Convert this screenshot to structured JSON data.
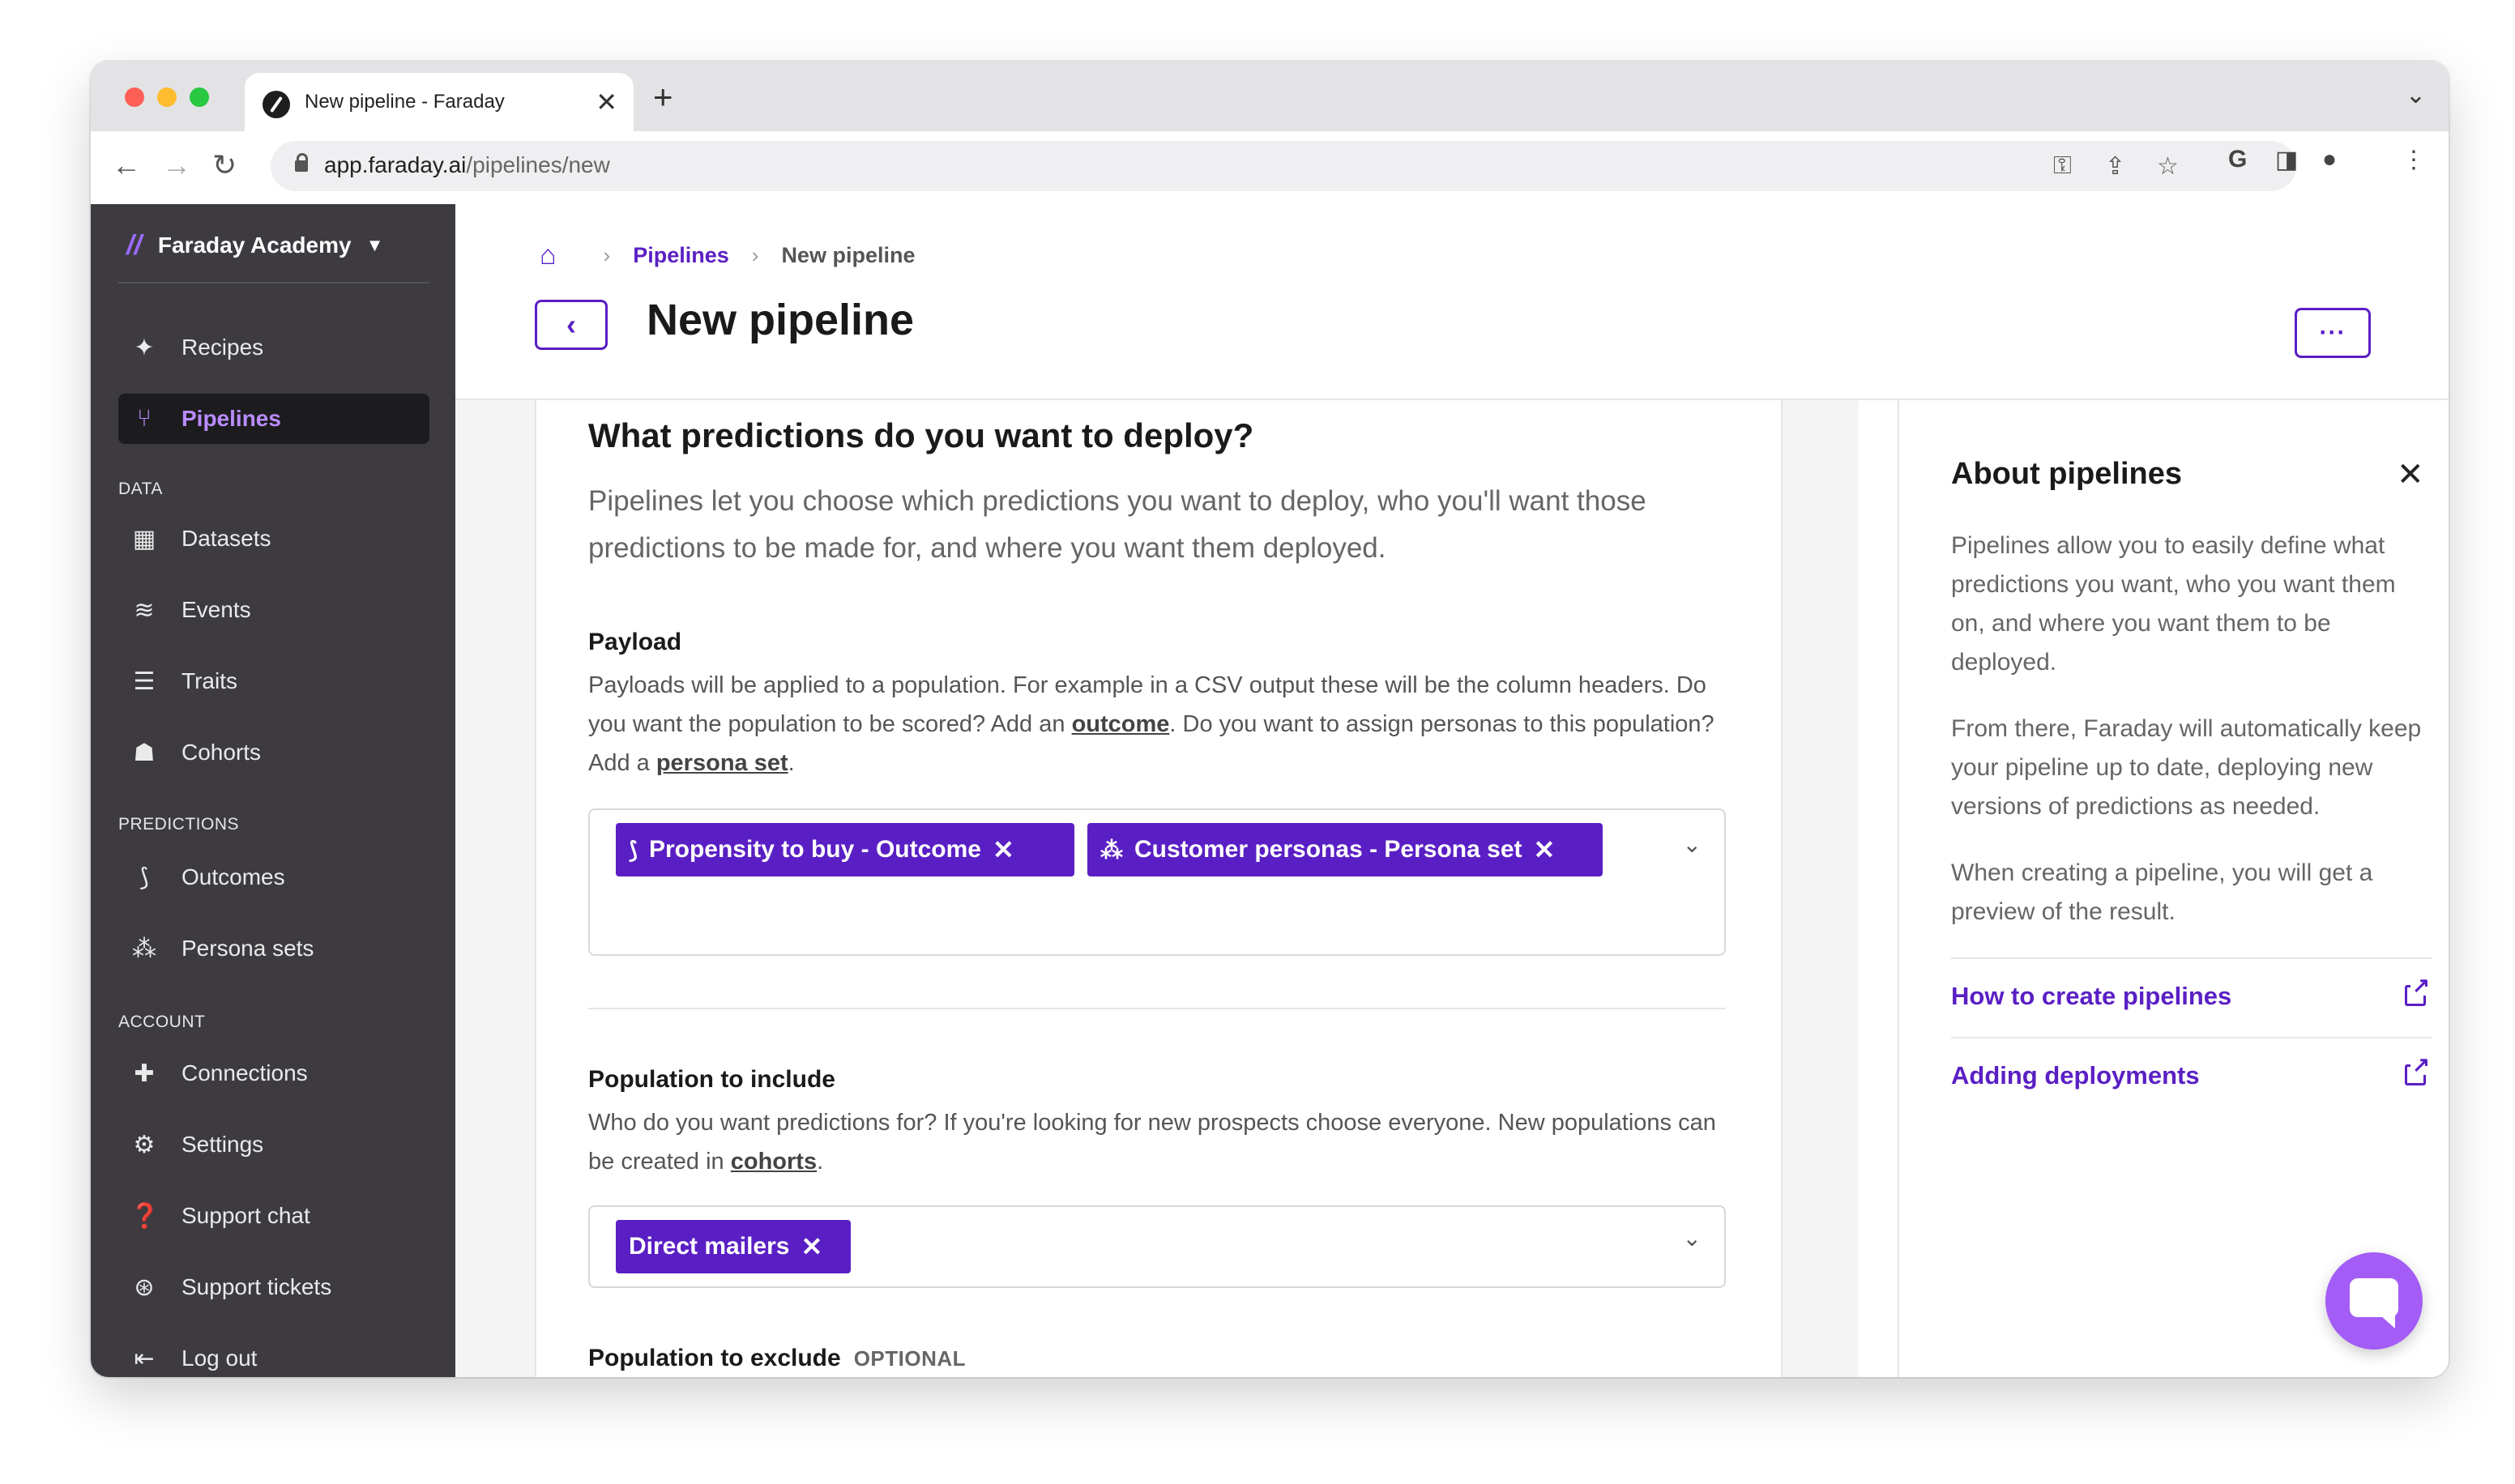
{
  "browser": {
    "tab_title": "New pipeline - Faraday",
    "tab_close": "✕",
    "new_tab": "+",
    "url_host": "app.faraday.ai",
    "url_path": "/pipelines/new"
  },
  "sidebar": {
    "org_name": "Faraday Academy",
    "items_top": [
      {
        "label": "Recipes",
        "icon": "magic-wand-icon"
      },
      {
        "label": "Pipelines",
        "icon": "pipeline-icon",
        "active": true
      }
    ],
    "sections": [
      {
        "title": "DATA",
        "items": [
          {
            "label": "Datasets",
            "icon": "grid-icon"
          },
          {
            "label": "Events",
            "icon": "layers-icon"
          },
          {
            "label": "Traits",
            "icon": "filter-icon"
          },
          {
            "label": "Cohorts",
            "icon": "people-icon"
          }
        ]
      },
      {
        "title": "PREDICTIONS",
        "items": [
          {
            "label": "Outcomes",
            "icon": "outcome-icon"
          },
          {
            "label": "Persona sets",
            "icon": "persona-icon"
          }
        ]
      },
      {
        "title": "ACCOUNT",
        "items": [
          {
            "label": "Connections",
            "icon": "puzzle-icon"
          },
          {
            "label": "Settings",
            "icon": "gear-icon"
          },
          {
            "label": "Support chat",
            "icon": "help-chat-icon"
          },
          {
            "label": "Support tickets",
            "icon": "lifebuoy-icon"
          },
          {
            "label": "Log out",
            "icon": "logout-icon"
          }
        ]
      }
    ]
  },
  "header": {
    "breadcrumb_parent": "Pipelines",
    "breadcrumb_current": "New pipeline",
    "title": "New pipeline",
    "more_label": "···"
  },
  "form": {
    "question": "What predictions do you want to deploy?",
    "question_desc": "Pipelines let you choose which predictions you want to deploy, who you'll want those predictions to be made for, and where you want them deployed.",
    "payload": {
      "title": "Payload",
      "desc_1": "Payloads will be applied to a population. For example in a CSV output these will be the column headers. Do you want the population to be scored? Add an ",
      "link_1": "outcome",
      "desc_2": ". Do you want to assign personas to this population? Add a ",
      "link_2": "persona set",
      "desc_3": ".",
      "chips": [
        "Propensity to buy - Outcome",
        "Customer personas - Persona set"
      ]
    },
    "include": {
      "title": "Population to include",
      "desc_1": "Who do you want predictions for? If you're looking for new prospects choose everyone. New populations can be created in ",
      "link_1": "cohorts",
      "desc_2": ".",
      "chips": [
        "Direct mailers"
      ]
    },
    "exclude": {
      "title": "Population to exclude",
      "optional": "OPTIONAL"
    }
  },
  "about": {
    "title": "About pipelines",
    "p1": "Pipelines allow you to easily define what predictions you want, who you want them on, and where you want them to be deployed.",
    "p2": "From there, Faraday will automatically keep your pipeline up to date, deploying new versions of predictions as needed.",
    "p3": "When creating a pipeline, you will get a preview of the result.",
    "links": [
      "How to create pipelines",
      "Adding deployments"
    ]
  },
  "colors": {
    "accent": "#5a1fc4",
    "sidebar_bg": "#3d3b40",
    "chat_bubble": "#a45cf6"
  }
}
